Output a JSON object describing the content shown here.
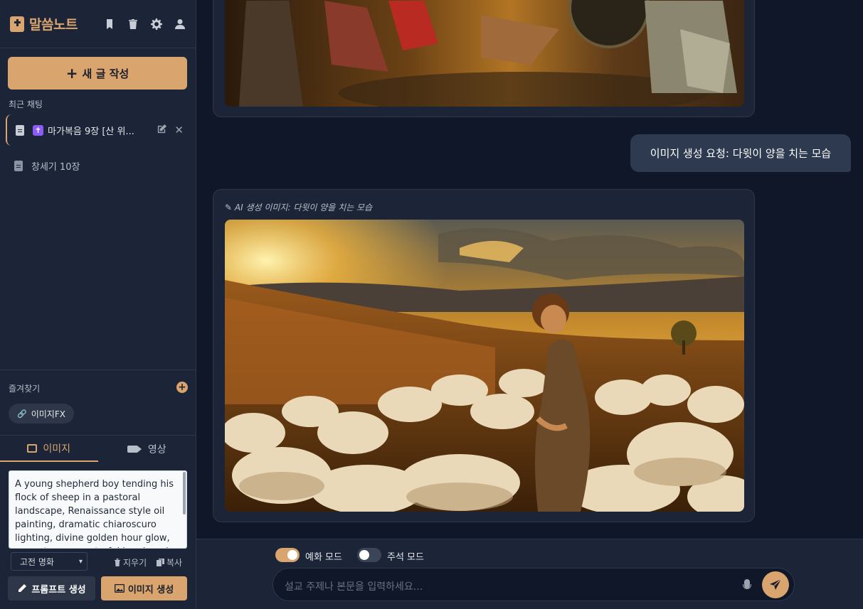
{
  "app": {
    "title": "말씀노트"
  },
  "sidebar": {
    "new_post_label": "새 글 작성",
    "recent_label": "최근 채팅",
    "recent_items": [
      {
        "emoji": "✝",
        "title": "마가복음 9장 [산 위..."
      },
      {
        "title": "창세기 10장"
      }
    ],
    "favorites_label": "즐겨찾기",
    "favorites": [
      {
        "label": "이미지FX"
      }
    ],
    "tabs": [
      {
        "label": "이미지"
      },
      {
        "label": "영상"
      }
    ],
    "prompt_text": "A young shepherd boy tending his flock of sheep in a pastoral landscape, Renaissance style oil painting, dramatic chiaroscuro lighting, divine golden hour glow, warm tones, masterful brushwork, detailed",
    "style_select": "고전 명화",
    "clear_label": "지우기",
    "copy_label": "복사",
    "prompt_button": "프롬프트 생성",
    "generate_button": "이미지 생성"
  },
  "main": {
    "user_message": "이미지 생성 요청: 다윗이 양을 치는 모습",
    "image_caption": "AI 생성 이미지: 다윗이 양을 치는 모습",
    "modes": [
      {
        "label": "예화 모드",
        "on": true
      },
      {
        "label": "주석 모드",
        "on": false
      }
    ],
    "input_placeholder": "설교 주제나 본문을 입력하세요..."
  },
  "colors": {
    "accent": "#d9a46e",
    "sidebar_bg": "#1c2537",
    "main_bg": "#0f1729"
  }
}
